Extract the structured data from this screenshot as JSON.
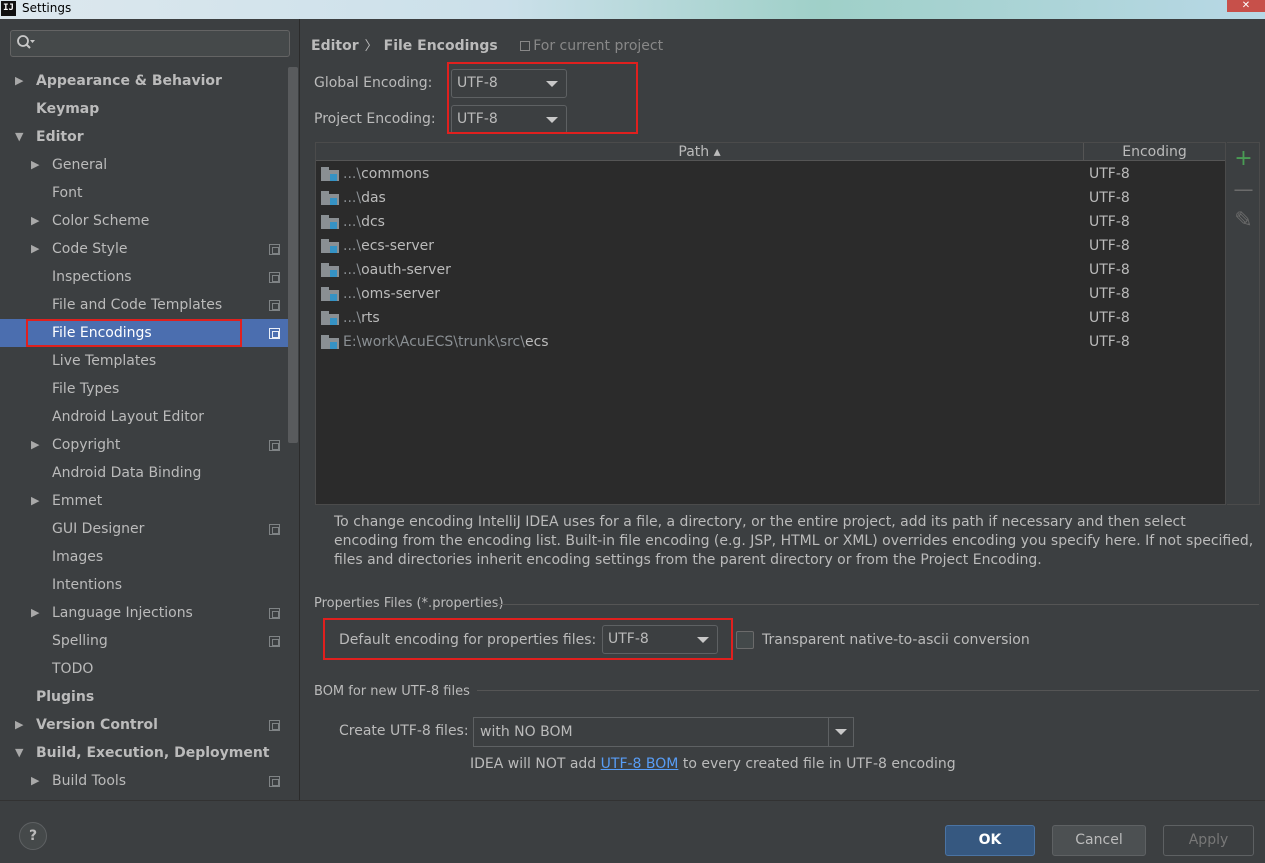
{
  "window": {
    "title": "Settings",
    "app_icon_text": "IJ",
    "close_symbol": "✕"
  },
  "search": {
    "placeholder": ""
  },
  "tree": [
    {
      "label": "Appearance & Behavior",
      "level": 0,
      "bold": true,
      "arrow": "▶",
      "proj": false
    },
    {
      "label": "Keymap",
      "level": 0,
      "bold": true,
      "arrow": "",
      "proj": false
    },
    {
      "label": "Editor",
      "level": 0,
      "bold": true,
      "arrow": "▼",
      "proj": false
    },
    {
      "label": "General",
      "level": 1,
      "bold": false,
      "arrow": "▶",
      "proj": false
    },
    {
      "label": "Font",
      "level": 1,
      "bold": false,
      "arrow": "",
      "proj": false
    },
    {
      "label": "Color Scheme",
      "level": 1,
      "bold": false,
      "arrow": "▶",
      "proj": false
    },
    {
      "label": "Code Style",
      "level": 1,
      "bold": false,
      "arrow": "▶",
      "proj": true
    },
    {
      "label": "Inspections",
      "level": 1,
      "bold": false,
      "arrow": "",
      "proj": true
    },
    {
      "label": "File and Code Templates",
      "level": 1,
      "bold": false,
      "arrow": "",
      "proj": true
    },
    {
      "label": "File Encodings",
      "level": 1,
      "bold": false,
      "arrow": "",
      "proj": true,
      "selected": true
    },
    {
      "label": "Live Templates",
      "level": 1,
      "bold": false,
      "arrow": "",
      "proj": false
    },
    {
      "label": "File Types",
      "level": 1,
      "bold": false,
      "arrow": "",
      "proj": false
    },
    {
      "label": "Android Layout Editor",
      "level": 1,
      "bold": false,
      "arrow": "",
      "proj": false
    },
    {
      "label": "Copyright",
      "level": 1,
      "bold": false,
      "arrow": "▶",
      "proj": true
    },
    {
      "label": "Android Data Binding",
      "level": 1,
      "bold": false,
      "arrow": "",
      "proj": false
    },
    {
      "label": "Emmet",
      "level": 1,
      "bold": false,
      "arrow": "▶",
      "proj": false
    },
    {
      "label": "GUI Designer",
      "level": 1,
      "bold": false,
      "arrow": "",
      "proj": true
    },
    {
      "label": "Images",
      "level": 1,
      "bold": false,
      "arrow": "",
      "proj": false
    },
    {
      "label": "Intentions",
      "level": 1,
      "bold": false,
      "arrow": "",
      "proj": false
    },
    {
      "label": "Language Injections",
      "level": 1,
      "bold": false,
      "arrow": "▶",
      "proj": true
    },
    {
      "label": "Spelling",
      "level": 1,
      "bold": false,
      "arrow": "",
      "proj": true
    },
    {
      "label": "TODO",
      "level": 1,
      "bold": false,
      "arrow": "",
      "proj": false
    },
    {
      "label": "Plugins",
      "level": 0,
      "bold": true,
      "arrow": "",
      "proj": false
    },
    {
      "label": "Version Control",
      "level": 0,
      "bold": true,
      "arrow": "▶",
      "proj": true
    },
    {
      "label": "Build, Execution, Deployment",
      "level": 0,
      "bold": true,
      "arrow": "▼",
      "proj": false
    },
    {
      "label": "Build Tools",
      "level": 1,
      "bold": false,
      "arrow": "▶",
      "proj": true
    }
  ],
  "breadcrumb": {
    "parent": "Editor",
    "separator": "〉",
    "current": "File Encodings",
    "scope": "For current project"
  },
  "global_encoding": {
    "label": "Global Encoding:",
    "value": "UTF-8"
  },
  "project_encoding": {
    "label": "Project Encoding:",
    "value": "UTF-8"
  },
  "table": {
    "headers": {
      "path": "Path ▴",
      "encoding": "Encoding"
    },
    "rows": [
      {
        "prefix": "...\\",
        "name": "commons",
        "encoding": "UTF-8"
      },
      {
        "prefix": "...\\",
        "name": "das",
        "encoding": "UTF-8"
      },
      {
        "prefix": "...\\",
        "name": "dcs",
        "encoding": "UTF-8"
      },
      {
        "prefix": "...\\",
        "name": "ecs-server",
        "encoding": "UTF-8"
      },
      {
        "prefix": "...\\",
        "name": "oauth-server",
        "encoding": "UTF-8"
      },
      {
        "prefix": "...\\",
        "name": "oms-server",
        "encoding": "UTF-8"
      },
      {
        "prefix": "...\\",
        "name": "rts",
        "encoding": "UTF-8"
      },
      {
        "prefix": "E:\\work\\AcuECS\\trunk\\src\\",
        "name": "ecs",
        "encoding": "UTF-8"
      }
    ],
    "tools": {
      "add": "+",
      "remove": "—",
      "edit": "✎"
    }
  },
  "help_text": "To change encoding IntelliJ IDEA uses for a file, a directory, or the entire project, add its path if necessary and then select encoding from the encoding list. Built-in file encoding (e.g. JSP, HTML or XML) overrides encoding you specify here. If not specified, files and directories inherit encoding settings from the parent directory or from the Project Encoding.",
  "properties": {
    "section_title": "Properties Files (*.properties)",
    "default_label": "Default encoding for properties files:",
    "default_value": "UTF-8",
    "transparent_label": "Transparent native-to-ascii conversion",
    "transparent_checked": false
  },
  "bom": {
    "section_title": "BOM for new UTF-8 files",
    "create_label": "Create UTF-8 files:",
    "create_value": "with NO BOM",
    "hint_before": "IDEA will NOT add ",
    "hint_link": "UTF-8 BOM",
    "hint_after": " to every created file in UTF-8 encoding"
  },
  "buttons": {
    "help": "?",
    "ok": "OK",
    "cancel": "Cancel",
    "apply": "Apply"
  },
  "colors": {
    "background": "#3c3f41",
    "selection": "#4b6eaf",
    "highlight_box": "#e0201e",
    "add_green": "#499c54",
    "link": "#589df6",
    "ok_blue": "#365880"
  }
}
